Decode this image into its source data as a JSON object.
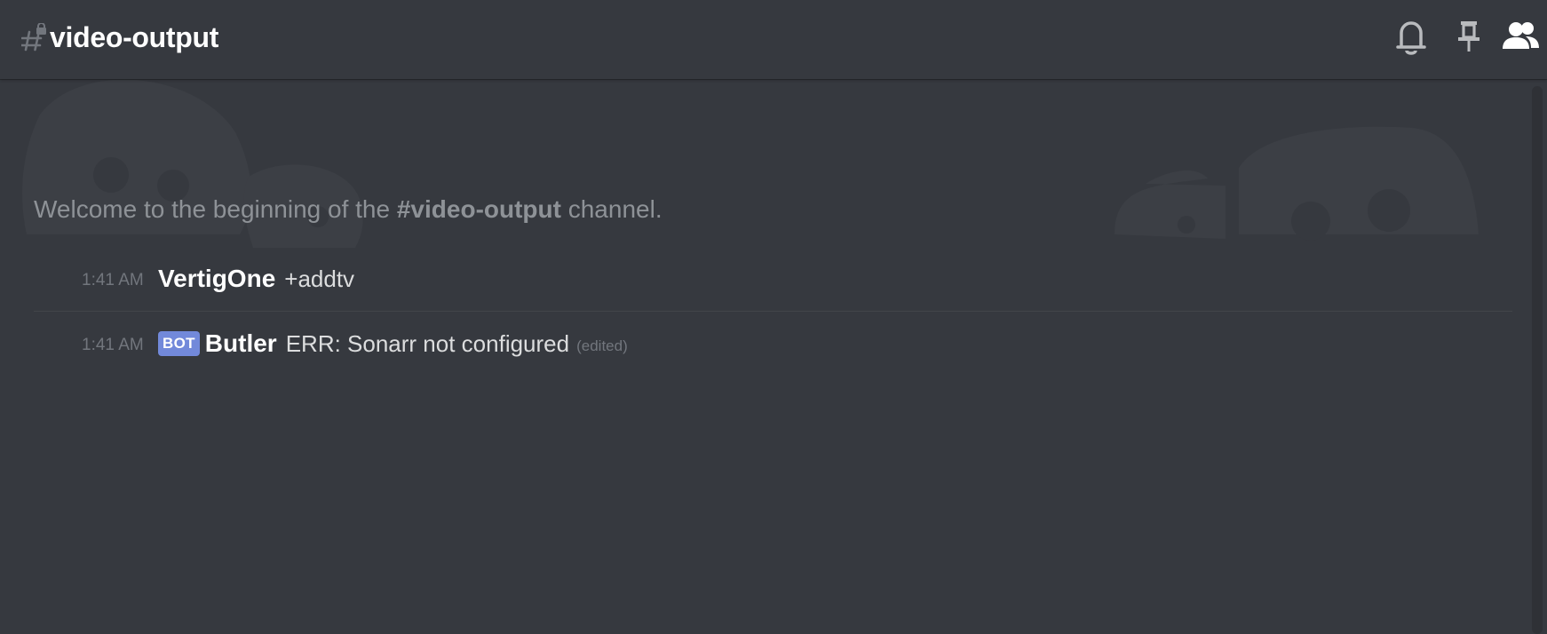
{
  "header": {
    "channel_name": "video-output",
    "icons": {
      "channel": "locked-hash-icon",
      "bell": "bell-icon",
      "pin": "pin-icon",
      "members": "members-icon"
    }
  },
  "welcome": {
    "prefix": "Welcome to the beginning of the ",
    "channel": "#video-output",
    "suffix": " channel."
  },
  "messages": [
    {
      "time": "1:41 AM",
      "author": "VertigOne",
      "content": "+addtv"
    },
    {
      "time": "1:41 AM",
      "badge": "BOT",
      "author": "Butler",
      "content": "ERR: Sonarr not configured",
      "edited": "(edited)"
    }
  ],
  "colors": {
    "background": "#36393f",
    "text_muted": "#8e9297",
    "timestamp": "#72767d",
    "bot_badge": "#7289da",
    "author": "#ffffff"
  }
}
